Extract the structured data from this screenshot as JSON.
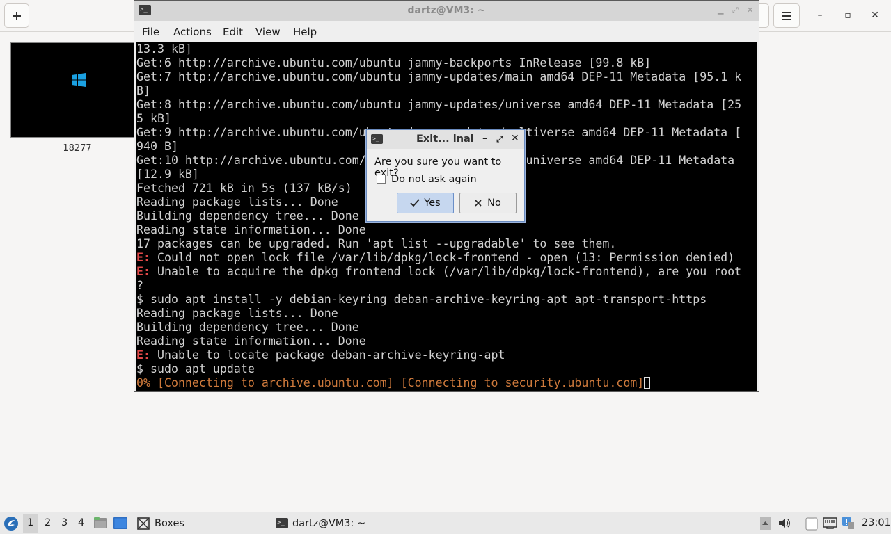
{
  "boxes_app": {
    "add_icon": "plus-icon",
    "menu_icon": "hamburger-icon",
    "window_controls": [
      "–",
      "▫",
      "✕"
    ],
    "vm_name": "18277"
  },
  "terminal": {
    "title": "dartz@VM3: ~",
    "menu": [
      "File",
      "Actions",
      "Edit",
      "View",
      "Help"
    ],
    "lines": [
      {
        "text": "13.3 kB]"
      },
      {
        "text": "Get:6 http://archive.ubuntu.com/ubuntu jammy-backports InRelease [99.8 kB]"
      },
      {
        "text": "Get:7 http://archive.ubuntu.com/ubuntu jammy-updates/main amd64 DEP-11 Metadata [95.1 k"
      },
      {
        "text": "B]"
      },
      {
        "text": "Get:8 http://archive.ubuntu.com/ubuntu jammy-updates/universe amd64 DEP-11 Metadata [25"
      },
      {
        "text": "5 kB]"
      },
      {
        "text": "Get:9 http://archive.ubuntu.com/ubuntu jammy-updates/multiverse amd64 DEP-11 Metadata ["
      },
      {
        "text": "940 B]"
      },
      {
        "text": "Get:10 http://archive.ubuntu.com/ubuntu jammy-backports/universe amd64 DEP-11 Metadata"
      },
      {
        "text": "[12.9 kB]"
      },
      {
        "text": "Fetched 721 kB in 5s (137 kB/s)"
      },
      {
        "text": "Reading package lists... Done"
      },
      {
        "text": "Building dependency tree... Done"
      },
      {
        "text": "Reading state information... Done"
      },
      {
        "text": "17 packages can be upgraded. Run 'apt list --upgradable' to see them."
      },
      {
        "prefix": "E:",
        "text": " Could not open lock file /var/lib/dpkg/lock-frontend - open (13: Permission denied)"
      },
      {
        "prefix": "E:",
        "text": " Unable to acquire the dpkg frontend lock (/var/lib/dpkg/lock-frontend), are you root"
      },
      {
        "text": "?"
      },
      {
        "text": "$ sudo apt install -y debian-keyring deban-archive-keyring-apt apt-transport-https"
      },
      {
        "text": "Reading package lists... Done"
      },
      {
        "text": "Building dependency tree... Done"
      },
      {
        "text": "Reading state information... Done"
      },
      {
        "prefix": "E:",
        "text": " Unable to locate package deban-archive-keyring-apt"
      },
      {
        "text": "$ sudo apt update"
      }
    ],
    "progress_line": "0% [Connecting to archive.ubuntu.com] [Connecting to security.ubuntu.com]"
  },
  "dialog": {
    "title": "Exit... inal",
    "message": "Are you sure you want to exit?",
    "checkbox_label": "Do not ask again",
    "checkbox_checked": false,
    "yes_label": "Yes",
    "no_label": "No"
  },
  "taskbar": {
    "workspaces": [
      "1",
      "2",
      "3",
      "4"
    ],
    "active_workspace": "1",
    "tasks": [
      {
        "label": "Boxes",
        "icon": "boxes-icon"
      },
      {
        "label": "dartz@VM3: ~",
        "icon": "terminal-icon"
      }
    ],
    "clock": "23:01"
  }
}
